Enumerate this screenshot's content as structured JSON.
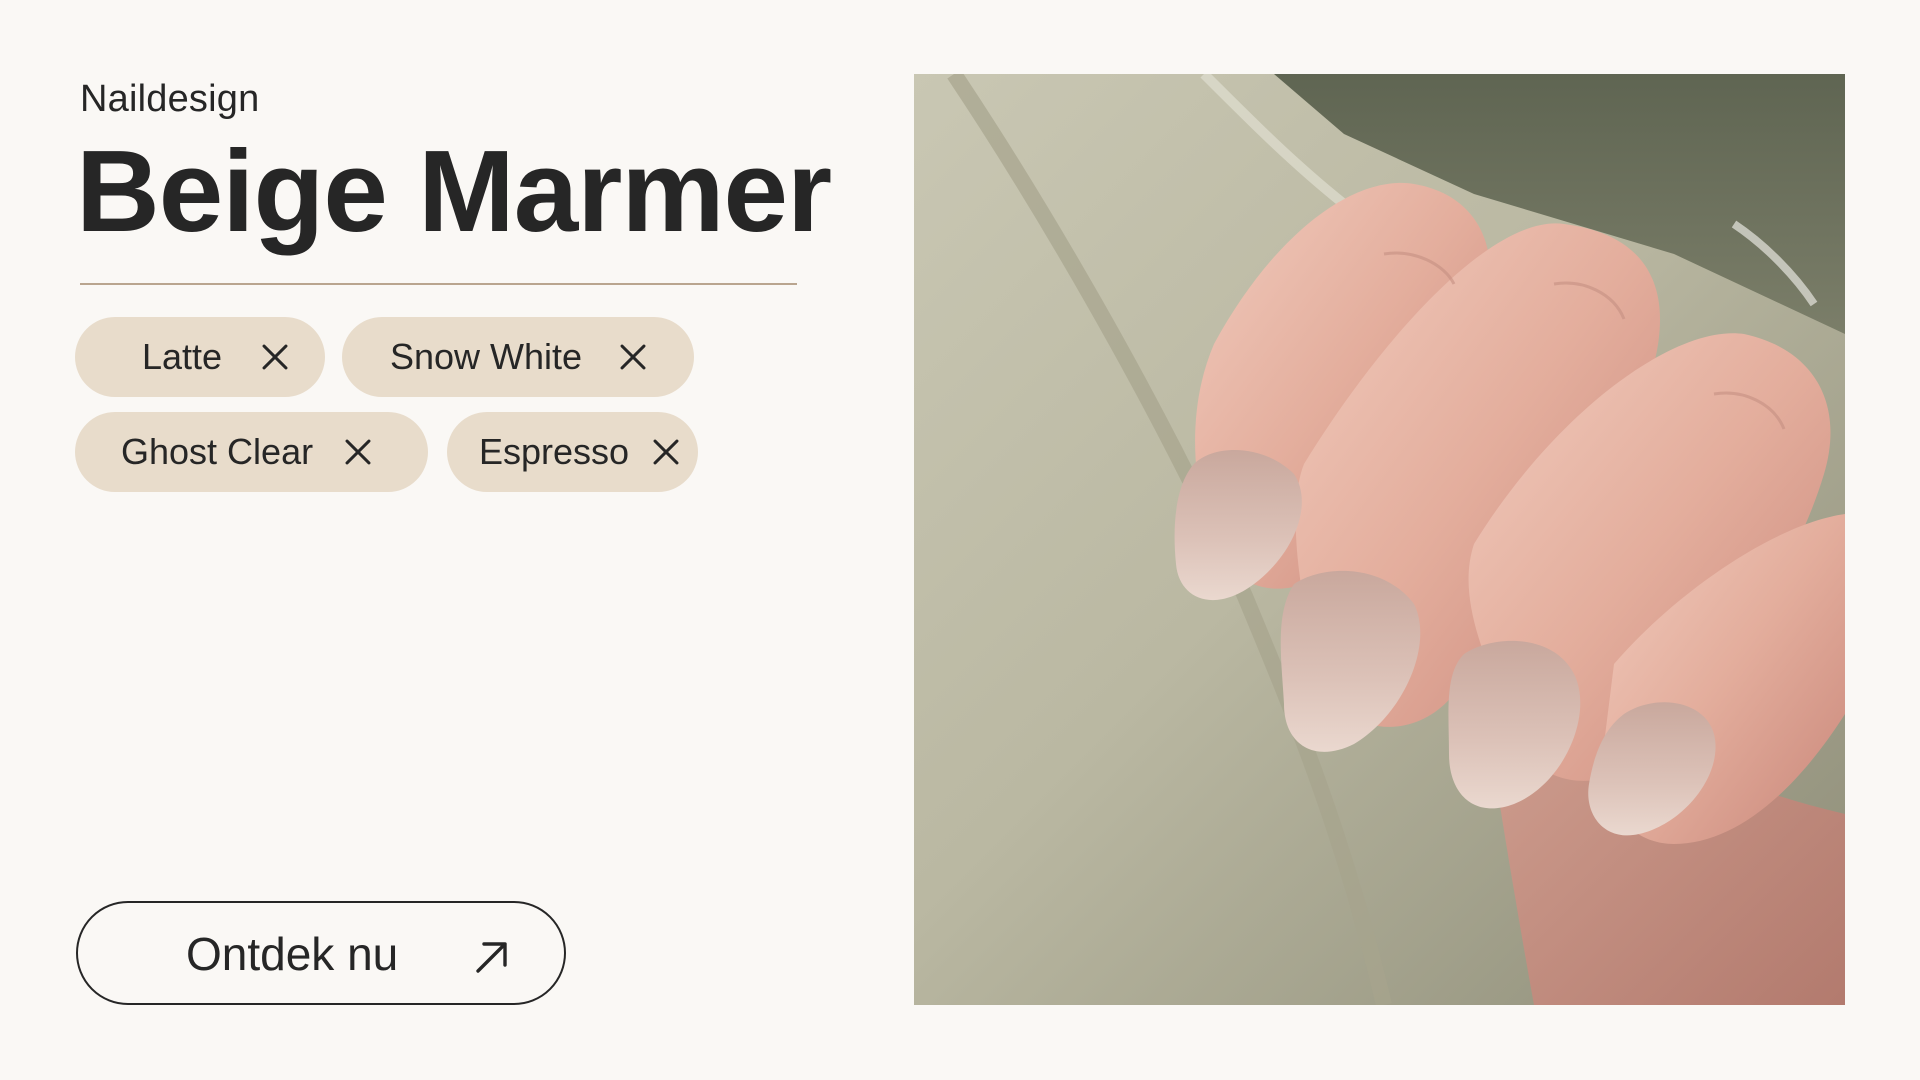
{
  "header": {
    "eyebrow": "Naildesign",
    "title": "Beige Marmer"
  },
  "tags": [
    {
      "label": "Latte",
      "remove_icon": "close-icon"
    },
    {
      "label": "Snow White",
      "remove_icon": "close-icon"
    },
    {
      "label": "Ghost Clear",
      "remove_icon": "close-icon"
    },
    {
      "label": "Espresso",
      "remove_icon": "close-icon"
    }
  ],
  "cta": {
    "label": "Ontdek nu",
    "icon": "arrow-up-right-icon"
  },
  "colors": {
    "background": "#faf8f5",
    "text": "#262626",
    "chip": "#e8dccb",
    "divider": "#b9a58f"
  }
}
